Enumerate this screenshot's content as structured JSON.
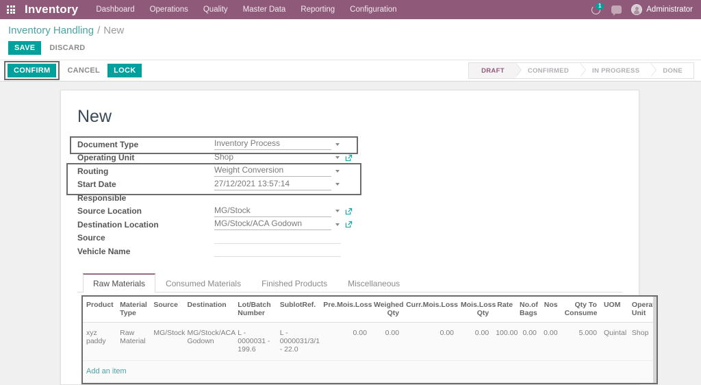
{
  "navbar": {
    "apps_icon": "apps-grid-icon",
    "brand": "Inventory",
    "menu": [
      {
        "label": "Dashboard"
      },
      {
        "label": "Operations"
      },
      {
        "label": "Quality"
      },
      {
        "label": "Master Data"
      },
      {
        "label": "Reporting"
      },
      {
        "label": "Configuration"
      }
    ],
    "activity_icon": "activity-clock-icon",
    "activity_badge": "1",
    "chat_icon": "chat-bubble-icon",
    "avatar_icon": "user-avatar-icon",
    "user_name": "Administrator",
    "bg_color": "#8f5a7a"
  },
  "control_panel": {
    "breadcrumb_root": "Inventory Handling",
    "breadcrumb_separator": "/",
    "breadcrumb_current": "New",
    "save_label": "SAVE",
    "discard_label": "DISCARD",
    "accent_color": "#00a09d"
  },
  "statusbar_row": {
    "confirm_label": "CONFIRM",
    "cancel_label": "CANCEL",
    "lock_label": "LOCK",
    "stages": [
      {
        "label": "DRAFT",
        "active": true
      },
      {
        "label": "CONFIRMED",
        "active": false
      },
      {
        "label": "IN PROGRESS",
        "active": false
      },
      {
        "label": "DONE",
        "active": false
      }
    ]
  },
  "form": {
    "title": "New",
    "fields": [
      {
        "label": "Document Type",
        "value": "Inventory Process",
        "caret": true,
        "ext": false,
        "empty": false
      },
      {
        "label": "Operating Unit",
        "value": "Shop",
        "caret": true,
        "ext": true,
        "empty": false
      },
      {
        "label": "Routing",
        "value": "Weight Conversion",
        "caret": true,
        "ext": false,
        "empty": false
      },
      {
        "label": "Start Date",
        "value": "27/12/2021 13:57:14",
        "caret": true,
        "ext": false,
        "empty": false
      },
      {
        "label": "Responsible",
        "value": "",
        "caret": false,
        "ext": false,
        "empty": true
      },
      {
        "label": "Source Location",
        "value": "MG/Stock",
        "caret": true,
        "ext": true,
        "empty": false
      },
      {
        "label": "Destination Location",
        "value": "MG/Stock/ACA Godown",
        "caret": true,
        "ext": true,
        "empty": false
      },
      {
        "label": "Source",
        "value": "",
        "caret": false,
        "ext": false,
        "empty": false
      },
      {
        "label": "Vehicle Name",
        "value": "",
        "caret": false,
        "ext": false,
        "empty": false
      }
    ]
  },
  "notebook": {
    "tabs": [
      {
        "label": "Raw Materials",
        "active": true
      },
      {
        "label": "Consumed Materials",
        "active": false
      },
      {
        "label": "Finished Products",
        "active": false
      },
      {
        "label": "Miscellaneous",
        "active": false
      }
    ]
  },
  "lines_table": {
    "columns": [
      {
        "label": "Product",
        "align": "left"
      },
      {
        "label": "Material Type",
        "align": "left"
      },
      {
        "label": "Source",
        "align": "left"
      },
      {
        "label": "Destination",
        "align": "left"
      },
      {
        "label": "Lot/Batch Number",
        "align": "left"
      },
      {
        "label": "SublotRef.",
        "align": "left"
      },
      {
        "label": "Pre.Mois.Loss",
        "align": "right"
      },
      {
        "label": "Weighed Qty",
        "align": "right"
      },
      {
        "label": "Curr.Mois.Loss",
        "align": "right"
      },
      {
        "label": "Mois.Loss Qty",
        "align": "right"
      },
      {
        "label": "Rate",
        "align": "right"
      },
      {
        "label": "No.of Bags",
        "align": "right"
      },
      {
        "label": "Nos",
        "align": "right"
      },
      {
        "label": "Qty To Consume",
        "align": "right"
      },
      {
        "label": "UOM",
        "align": "left"
      },
      {
        "label": "Operating Unit",
        "align": "left"
      }
    ],
    "rows": [
      {
        "cells": [
          "xyz paddy",
          "Raw Material",
          "MG/Stock",
          "MG/Stock/ACA Godown",
          "L - 0000031 - 199.6",
          "L - 0000031/3/1 - 22.0",
          "0.00",
          "0.00",
          "0.00",
          "0.00",
          "100.00",
          "0.00",
          "0.00",
          "5.000",
          "Quintal",
          "Shop"
        ]
      }
    ],
    "add_item_label": "Add an item"
  }
}
